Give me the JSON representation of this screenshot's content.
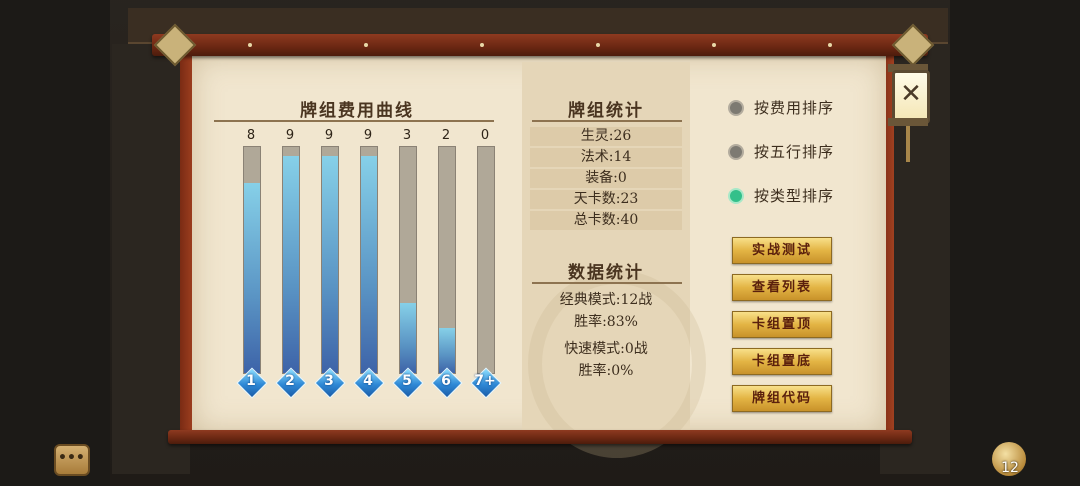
{
  "curve": {
    "title": "牌组费用曲线",
    "bars": [
      {
        "cost_label": "1",
        "count": "8",
        "fill": 0.84
      },
      {
        "cost_label": "2",
        "count": "9",
        "fill": 0.96
      },
      {
        "cost_label": "3",
        "count": "9",
        "fill": 0.96
      },
      {
        "cost_label": "4",
        "count": "9",
        "fill": 0.96
      },
      {
        "cost_label": "5",
        "count": "3",
        "fill": 0.31
      },
      {
        "cost_label": "6",
        "count": "2",
        "fill": 0.2
      },
      {
        "cost_label": "7+",
        "count": "0",
        "fill": 0
      }
    ]
  },
  "chart_data": {
    "type": "bar",
    "categories": [
      "1",
      "2",
      "3",
      "4",
      "5",
      "6",
      "7+"
    ],
    "values": [
      8,
      9,
      9,
      9,
      3,
      2,
      0
    ],
    "title": "牌组费用曲线"
  },
  "deck_stats": {
    "title": "牌组统计",
    "rows": [
      "生灵:26",
      "法术:14",
      "装备:0",
      "天卡数:23",
      "总卡数:40"
    ]
  },
  "data_stats": {
    "title": "数据统计",
    "classic_mode": "经典模式:12战",
    "classic_winrate": "胜率:83%",
    "fast_mode": "快速模式:0战",
    "fast_winrate": "胜率:0%"
  },
  "sort_options": [
    {
      "label": "按费用排序",
      "selected": false
    },
    {
      "label": "按五行排序",
      "selected": false
    },
    {
      "label": "按类型排序",
      "selected": true
    }
  ],
  "actions": {
    "battle_test": "实战测试",
    "view_list": "查看列表",
    "pin_top": "卡组置顶",
    "pin_bottom": "卡组置底",
    "deck_code": "牌组代码"
  },
  "close_icon": "close-icon",
  "chat_dots": "•••",
  "corner_count": "12",
  "colors": {
    "bar_fill": "#5a94c4",
    "gold_button": "#e3b444",
    "radio_on": "#34c08a",
    "scroll_rod": "#7a2b14"
  }
}
